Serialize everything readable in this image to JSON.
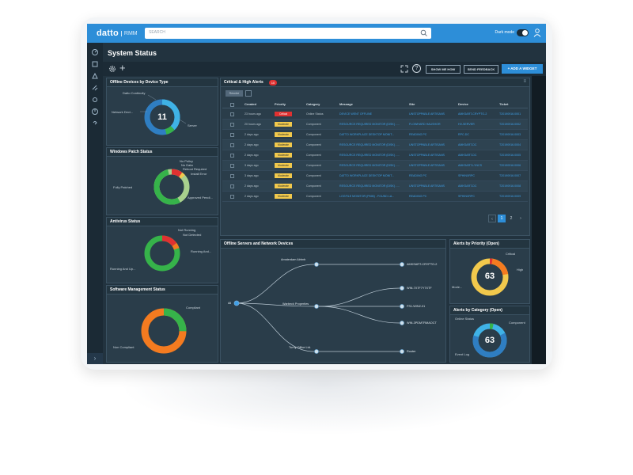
{
  "app": {
    "logo": "datto",
    "logo_sub": "RMM",
    "search_placeholder": "SEARCH",
    "dark_mode_label": "Dark mode",
    "page_title": "System Status"
  },
  "toolbar": {
    "btn_show_me_how": "SHOW ME HOW",
    "btn_send_feedback": "SEND FEEDBACK",
    "btn_add_widget": "+ ADD A WIDGET"
  },
  "widgets": {
    "offline_devices": {
      "title": "Offline Devices by Device Type",
      "center_value": "11",
      "labels": [
        "Datto Continuity",
        "Network Devi...",
        "Server"
      ]
    },
    "windows_patch": {
      "title": "Windows Patch Status",
      "labels": [
        "No Policy",
        "No Data",
        "Reboot Required",
        "Install Error",
        "Fully Patched",
        "Approved Pendi..."
      ]
    },
    "antivirus": {
      "title": "Antivirus Status",
      "labels": [
        "Not Running",
        "Not Detected",
        "Running And...",
        "Running And Up..."
      ]
    },
    "software_mgmt": {
      "title": "Software Management Status",
      "labels": [
        "Compliant",
        "Non Compliant"
      ]
    },
    "critical_alerts": {
      "title": "Critical & High Alerts",
      "count": "10",
      "filter_label": "Resolve",
      "columns": [
        "Created",
        "Priority",
        "Category",
        "Message",
        "Site",
        "Device",
        "Ticket"
      ],
      "rows": [
        {
          "created": "23 hours ago",
          "priority": "Critical",
          "category": "Online Status",
          "message": "DEVICE WENT OFFLINE",
          "site": "UNSTOPPABLE ARTISANS",
          "device": "AMKSART-CRYPTO-2",
          "ticket": "T20190916.0001"
        },
        {
          "created": "20 hours ago",
          "priority": "Moderate",
          "category": "Component",
          "message": "RESOURCE REQUIRED MONITOR (DISK) - ...",
          "site": "FLOWHARD HAUSHOR",
          "device": "HV-SERVER",
          "ticket": "T20190916.0002"
        },
        {
          "created": "2 days ago",
          "priority": "Moderate",
          "category": "Component",
          "message": "DATTO WORKPLACE DESKTOP MONIT...",
          "site": "READING PC",
          "device": "RPC-DC",
          "ticket": "T20190916.0003"
        },
        {
          "created": "2 days ago",
          "priority": "Moderate",
          "category": "Component",
          "message": "RESOURCE REQUIRED MONITOR (DISK) - ...",
          "site": "UNSTOPPABLE ARTISANS",
          "device": "AMKSART-DC",
          "ticket": "T20190916.0004"
        },
        {
          "created": "2 days ago",
          "priority": "Moderate",
          "category": "Component",
          "message": "RESOURCE REQUIRED MONITOR (DISK) - ...",
          "site": "UNSTOPPABLE ARTISANS",
          "device": "AMKSART-DC",
          "ticket": "T20190916.0005"
        },
        {
          "created": "3 days ago",
          "priority": "Moderate",
          "category": "Component",
          "message": "RESOURCE REQUIRED MONITOR (DISK) - ...",
          "site": "UNSTOPPABLE ARTISANS",
          "device": "AMKSART-LYNCS",
          "ticket": "T20190916.0006"
        },
        {
          "created": "3 days ago",
          "priority": "Moderate",
          "category": "Component",
          "message": "DATTO WORKPLACE DESKTOP MONIT...",
          "site": "READING PC",
          "device": "SPHINXRPC",
          "ticket": "T20190916.0007"
        },
        {
          "created": "2 days ago",
          "priority": "Moderate",
          "category": "Component",
          "message": "RESOURCE REQUIRED MONITOR (DISK) - ...",
          "site": "UNSTOPPABLE ARTISANS",
          "device": "AMKSART-DC",
          "ticket": "T20190916.0008"
        },
        {
          "created": "2 days ago",
          "priority": "Moderate",
          "category": "Component",
          "message": "LOGFILE MONITOR (PMM) - FOUND LA...",
          "site": "READING PC",
          "device": "SPHINXRPC",
          "ticket": "T20190916.0009"
        }
      ],
      "pages": [
        "1",
        "2"
      ]
    },
    "offline_servers": {
      "title": "Offline Servers and Network Devices",
      "root": "All",
      "sites": [
        "Amsterdam Airbnb",
        "Warbeck Properties",
        "Turny Office Ltd."
      ],
      "devices": [
        "AMKSART-CRYPTO-2",
        "WIN-7X7F7Y7XTF",
        "FS1-WIN2-01",
        "WIN-3PDM7RMAOCT",
        "Router"
      ]
    },
    "alerts_priority": {
      "title": "Alerts by Priority (Open)",
      "center_value": "63",
      "labels": [
        "Critical",
        "High",
        "Mode..."
      ]
    },
    "alerts_category": {
      "title": "Alerts by Category (Open)",
      "center_value": "63",
      "labels": [
        "Online Status",
        "Component",
        "Event Log"
      ]
    }
  },
  "colors": {
    "accent": "#2d8ed8",
    "critical": "#e03131",
    "moderate": "#f2c94c",
    "green": "#36b34a",
    "orange": "#f47b20",
    "blue": "#2f7ec2",
    "light_blue": "#3fb2e6"
  },
  "icons": [
    "search-icon",
    "user-icon",
    "gear-icon",
    "plus-icon",
    "expand-icon",
    "help-icon",
    "menu-icon"
  ]
}
